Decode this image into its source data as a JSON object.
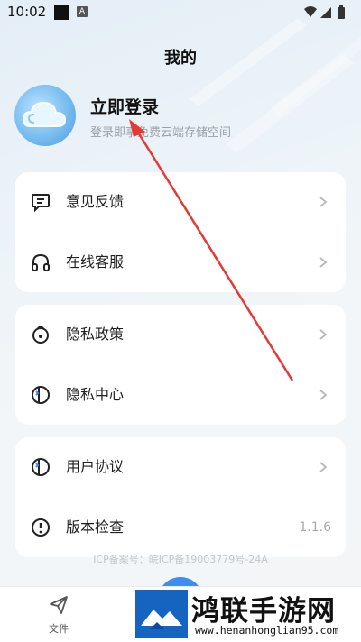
{
  "status_bar": {
    "time": "10:02",
    "a_icon": "A",
    "icons": [
      "wifi-icon",
      "signal-icon",
      "battery-icon"
    ]
  },
  "header": {
    "title": "我的"
  },
  "profile": {
    "login_title": "立即登录",
    "login_subtitle": "登录即享免费云端存储空间",
    "avatar_icon": "cloud-icon"
  },
  "card1": {
    "items": [
      {
        "label": "意见反馈",
        "icon": "feedback-icon"
      },
      {
        "label": "在线客服",
        "icon": "headset-icon"
      }
    ]
  },
  "card2": {
    "items": [
      {
        "label": "隐私政策",
        "icon": "privacy-policy-icon"
      },
      {
        "label": "隐私中心",
        "icon": "privacy-center-icon"
      }
    ]
  },
  "card3": {
    "items": [
      {
        "label": "用户协议",
        "icon": "user-agreement-icon"
      },
      {
        "label": "版本检查",
        "icon": "info-icon",
        "value": "1.1.6"
      }
    ]
  },
  "footer": {
    "icp": "ICP备案号：皖ICP备19003779号-24A"
  },
  "tabbar": {
    "files_label": "文件"
  },
  "watermark": {
    "text": "鸿联手游网",
    "url": "www.henanhonglian95.com"
  },
  "colors": {
    "accent": "#3d8df2",
    "arrow": "#e53935",
    "background": "#eef3f7"
  }
}
